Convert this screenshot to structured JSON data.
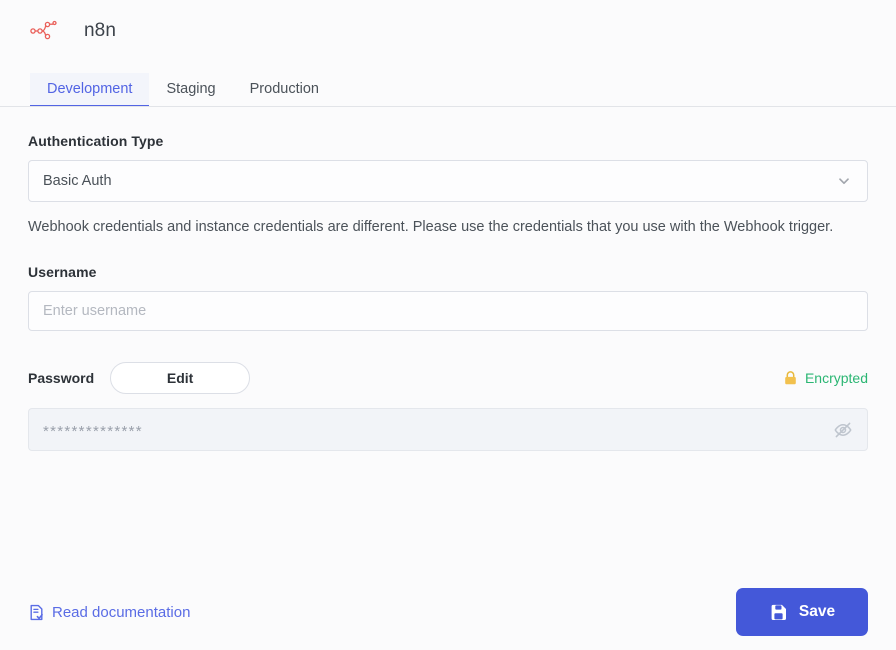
{
  "header": {
    "logo_icon": "n8n-logo-icon",
    "title": "n8n"
  },
  "tabs": [
    {
      "label": "Development",
      "active": true
    },
    {
      "label": "Staging",
      "active": false
    },
    {
      "label": "Production",
      "active": false
    }
  ],
  "form": {
    "auth_type": {
      "label": "Authentication Type",
      "value": "Basic Auth",
      "chevron_icon": "chevron-down-icon"
    },
    "hint": "Webhook credentials and instance credentials are different. Please use the credentials that you use with the Webhook trigger.",
    "username": {
      "label": "Username",
      "value": "",
      "placeholder": "Enter username"
    },
    "password": {
      "label": "Password",
      "edit_label": "Edit",
      "encrypted_label": "Encrypted",
      "lock_icon": "lock-icon",
      "masked_value": "**************",
      "eye_icon": "eye-off-icon"
    }
  },
  "footer": {
    "doc_link_label": "Read documentation",
    "doc_icon": "document-check-icon",
    "save_label": "Save",
    "save_icon": "floppy-disk-save-icon"
  },
  "colors": {
    "accent_blue": "#4458d9",
    "tab_active_blue": "#5264e4",
    "link_blue": "#5a6ce5",
    "encrypted_green": "#2bb673",
    "lock_yellow": "#f0c killed"
  }
}
